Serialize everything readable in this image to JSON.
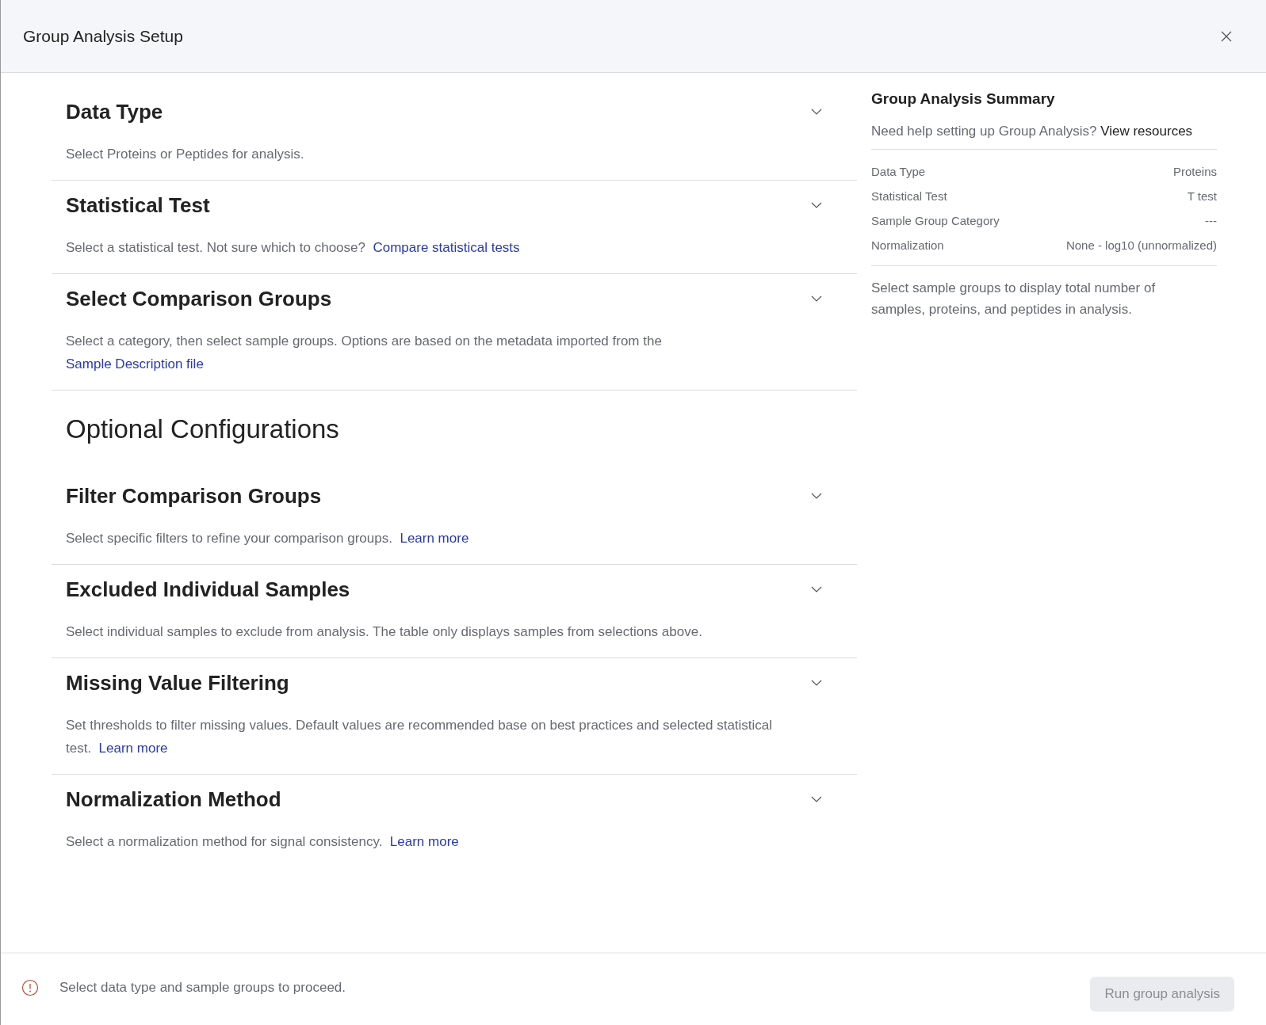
{
  "dialog": {
    "title": "Group Analysis Setup"
  },
  "sections": [
    {
      "title": "Data Type",
      "description": "Select Proteins or Peptides for analysis.",
      "expanded": false
    },
    {
      "title": "Statistical Test",
      "description": "Select a statistical test. Not sure which to choose?",
      "link": "Compare statistical tests",
      "expanded": false
    },
    {
      "title": "Select Comparison Groups",
      "description": "Select a category, then select sample groups. Options are based on the metadata imported from the",
      "link": "Sample Description file",
      "expanded": false
    }
  ],
  "optional_heading": "Optional Configurations",
  "optional_sections": [
    {
      "title": "Filter Comparison Groups",
      "description": "Select specific filters to refine your comparison groups.",
      "link": "Learn more",
      "expanded": false
    },
    {
      "title": "Excluded Individual Samples",
      "description": "Select individual samples to exclude from analysis. The table only displays samples from selections above.",
      "expanded": false
    },
    {
      "title": "Missing Value Filtering",
      "description": "Set thresholds to filter missing values. Default values are recommended base on best practices and selected statistical test.",
      "link": "Learn more",
      "expanded": false
    },
    {
      "title": "Normalization Method",
      "description": "Select a normalization method for signal consistency.",
      "link": "Learn more",
      "expanded": false
    }
  ],
  "summary": {
    "title": "Group Analysis Summary",
    "help_text": "Need help setting up Group Analysis?",
    "help_link": "View resources",
    "rows": [
      {
        "label": "Data Type",
        "value": "Proteins"
      },
      {
        "label": "Statistical Test",
        "value": "T test"
      },
      {
        "label": "Sample Group Category",
        "value": "---"
      },
      {
        "label": "Normalization",
        "value": "None - log10 (unnormalized)"
      }
    ],
    "note": "Select sample groups to display total number of samples, proteins, and peptides in analysis."
  },
  "footer": {
    "message": "Select data type and sample groups to proceed.",
    "button": {
      "label": "Run group analysis",
      "disabled": true
    }
  }
}
